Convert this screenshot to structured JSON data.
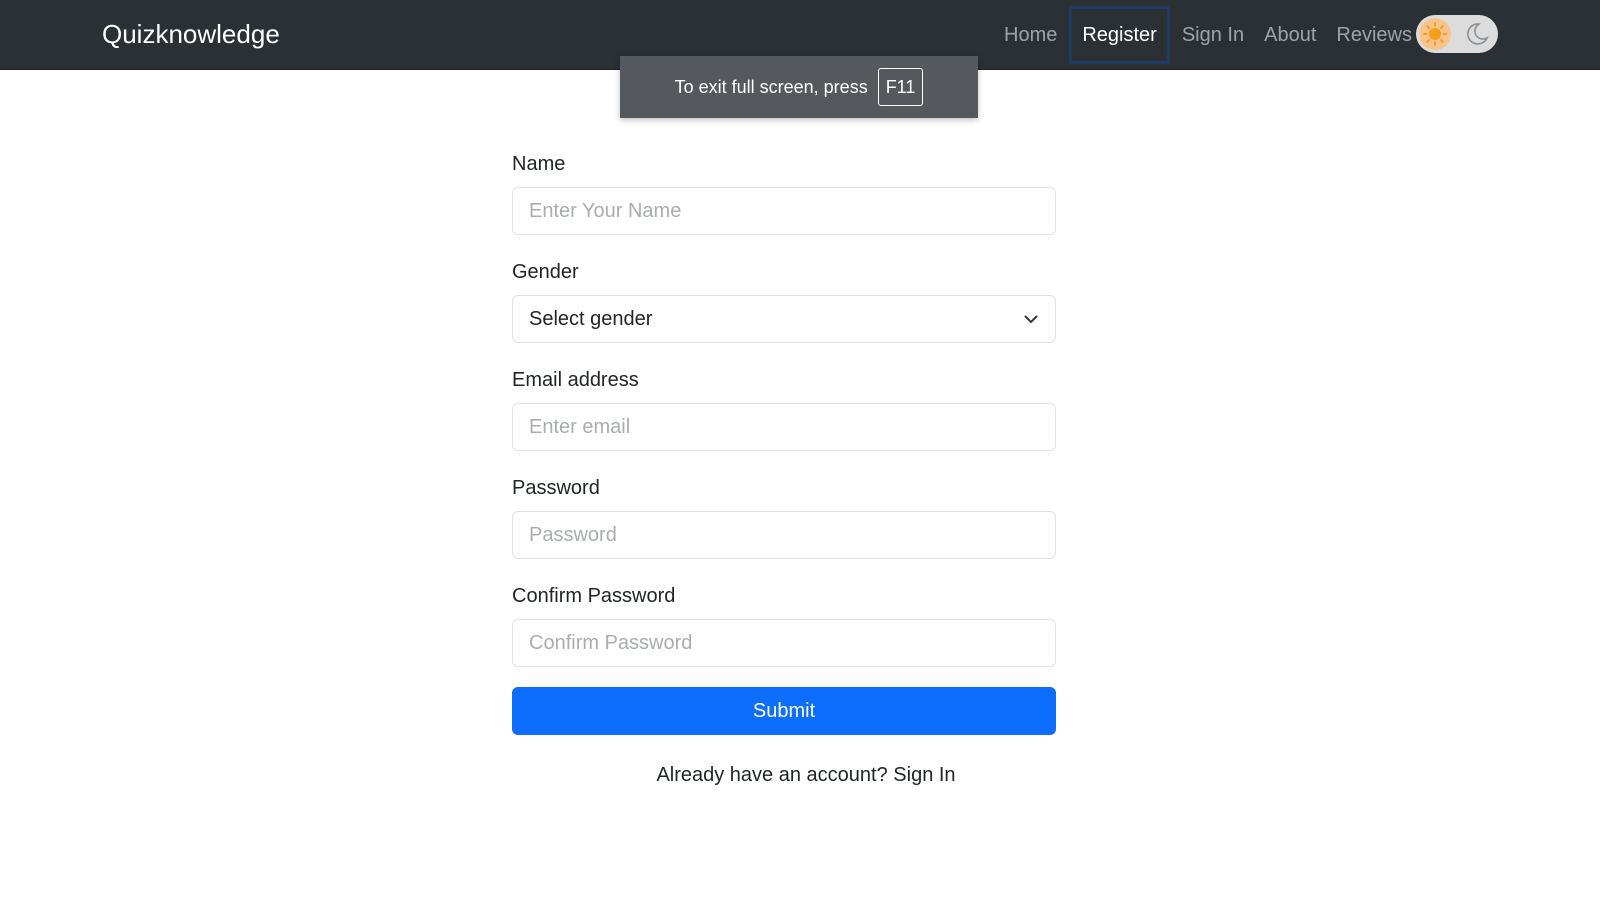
{
  "navbar": {
    "brand": "Quizknowledge",
    "links": [
      {
        "label": "Home"
      },
      {
        "label": "Register",
        "active": true
      },
      {
        "label": "Sign In"
      },
      {
        "label": "About"
      },
      {
        "label": "Reviews"
      }
    ],
    "theme_toggle": {
      "state": "light",
      "icons": [
        "sun-icon",
        "moon-icon"
      ]
    }
  },
  "fullscreen_toast": {
    "message": "To exit full screen, press",
    "key": "F11"
  },
  "form": {
    "name": {
      "label": "Name",
      "placeholder": "Enter Your Name"
    },
    "gender": {
      "label": "Gender",
      "selected": "Select gender"
    },
    "email": {
      "label": "Email address",
      "placeholder": "Enter email"
    },
    "password": {
      "label": "Password",
      "placeholder": "Password"
    },
    "confirm_password": {
      "label": "Confirm Password",
      "placeholder": "Confirm Password"
    },
    "submit_label": "Submit"
  },
  "footer": {
    "prompt": "Already have an account?",
    "link": "Sign In"
  },
  "colors": {
    "navbar_bg": "#2b3035",
    "primary": "#0d6efd",
    "toast_bg": "#55585d"
  }
}
